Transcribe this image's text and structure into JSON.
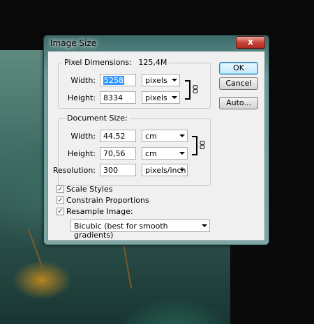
{
  "dialog": {
    "title": "Image Size",
    "close_label": "x"
  },
  "pixel_dimensions": {
    "label": "Pixel Dimensions:",
    "value": "125,4M",
    "width_label": "Width:",
    "width_value": "5258",
    "width_unit": "pixels",
    "height_label": "Height:",
    "height_value": "8334",
    "height_unit": "pixels"
  },
  "document_size": {
    "label": "Document Size:",
    "width_label": "Width:",
    "width_value": "44,52",
    "width_unit": "cm",
    "height_label": "Height:",
    "height_value": "70,56",
    "height_unit": "cm",
    "resolution_label": "Resolution:",
    "resolution_value": "300",
    "resolution_unit": "pixels/inch"
  },
  "buttons": {
    "ok": "OK",
    "cancel": "Cancel",
    "auto": "Auto..."
  },
  "options": {
    "scale_styles": {
      "label": "Scale Styles",
      "checked": true
    },
    "constrain_proportions": {
      "label": "Constrain Proportions",
      "checked": true
    },
    "resample_image": {
      "label": "Resample Image:",
      "checked": true
    },
    "resample_method": "Bicubic (best for smooth gradients)"
  },
  "icons": {
    "link": "chain-link-icon",
    "check": "checkmark-icon",
    "dropdown": "chevron-down-icon"
  },
  "colors": {
    "titlebar": "#6d9c9b",
    "close": "#c9463a",
    "selection": "#3399ff"
  }
}
